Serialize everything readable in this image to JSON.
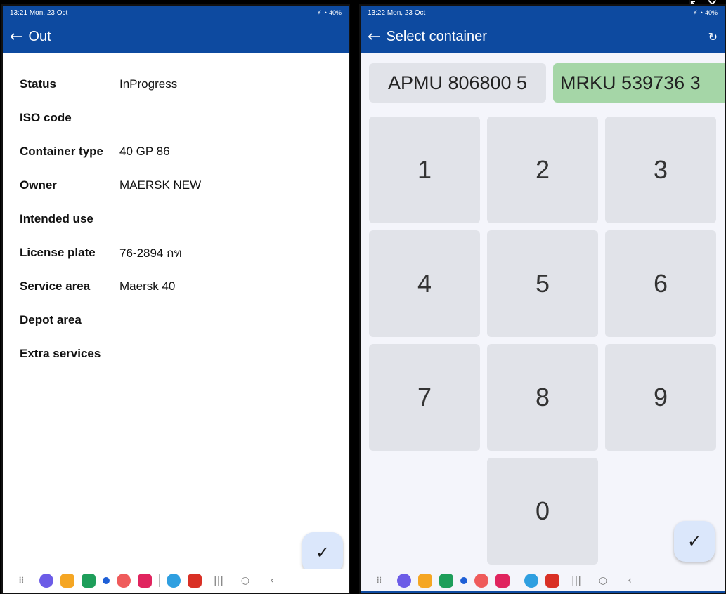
{
  "left": {
    "status_bar": {
      "time": "13:21",
      "date": "Mon, 23 Oct",
      "right": "⚡ ◔ 40%"
    },
    "app_bar": {
      "title": "Out"
    },
    "details": [
      {
        "label": "Status",
        "value": "InProgress"
      },
      {
        "label": "ISO code",
        "value": ""
      },
      {
        "label": "Container type",
        "value": "40 GP 86"
      },
      {
        "label": "Owner",
        "value": "MAERSK NEW"
      },
      {
        "label": "Intended use",
        "value": ""
      },
      {
        "label": "License plate",
        "value": "76-2894 กท"
      },
      {
        "label": "Service area",
        "value": "Maersk 40"
      },
      {
        "label": "Depot area",
        "value": ""
      },
      {
        "label": "Extra services",
        "value": ""
      }
    ]
  },
  "right": {
    "status_bar": {
      "time": "13:22",
      "date": "Mon, 23 Oct",
      "right": "⚡ ◔ 40%"
    },
    "app_bar": {
      "title": "Select container"
    },
    "chips": [
      {
        "label": "APMU 806800 5",
        "selected": false
      },
      {
        "label": "MRKU 539736 3",
        "selected": true
      }
    ],
    "keys": [
      "1",
      "2",
      "3",
      "4",
      "5",
      "6",
      "7",
      "8",
      "9",
      "0"
    ]
  },
  "colors": {
    "primary": "#0d4aa0",
    "chip_selected": "#a5d6a7",
    "chip_default": "#e1e3e9",
    "fab": "#dbe7fb"
  },
  "icons": {
    "back": "arrow-left-icon",
    "refresh": "refresh-icon",
    "confirm": "check-icon"
  }
}
